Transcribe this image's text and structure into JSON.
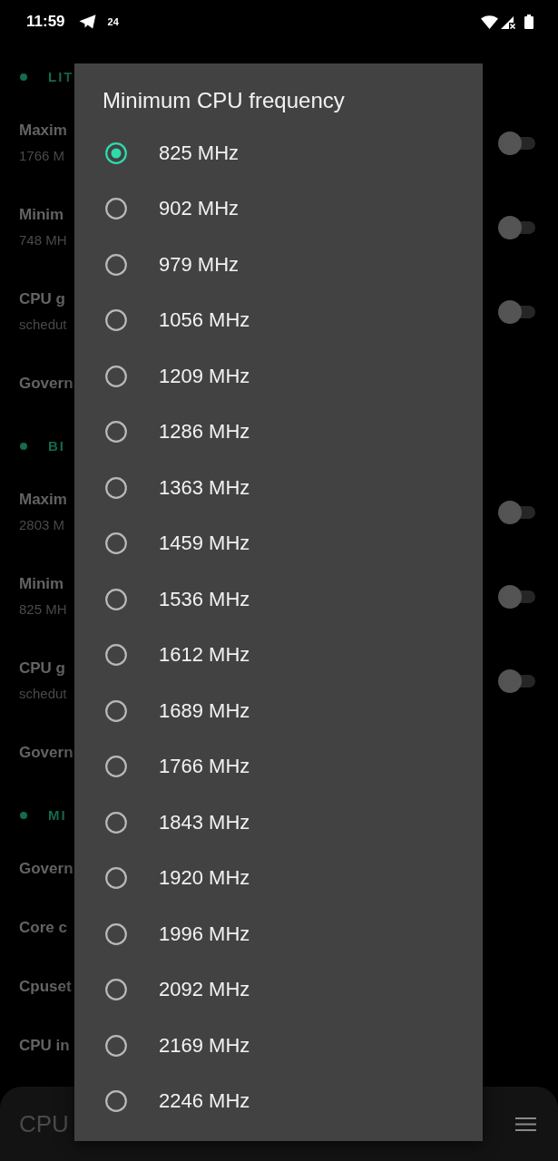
{
  "status_bar": {
    "time": "11:59",
    "notification_text": "24"
  },
  "sections": [
    {
      "header": "LIT",
      "items": [
        {
          "kind": "toggle",
          "title": "Maxim",
          "value": "1766 M",
          "on": false
        },
        {
          "kind": "toggle",
          "title": "Minim",
          "value": "748 MH",
          "on": false
        },
        {
          "kind": "toggle",
          "title": "CPU g",
          "value": "schedut",
          "on": false
        },
        {
          "kind": "plain",
          "title": "Govern"
        }
      ]
    },
    {
      "header": "BI",
      "items": [
        {
          "kind": "toggle",
          "title": "Maxim",
          "value": "2803 M",
          "on": false
        },
        {
          "kind": "toggle",
          "title": "Minim",
          "value": "825 MH",
          "on": false
        },
        {
          "kind": "toggle",
          "title": "CPU g",
          "value": "schedut",
          "on": false
        },
        {
          "kind": "plain",
          "title": "Govern"
        }
      ]
    },
    {
      "header": "MI",
      "items": [
        {
          "kind": "plain",
          "title": "Govern"
        },
        {
          "kind": "plain",
          "title": "Core c"
        },
        {
          "kind": "plain",
          "title": "Cpuset"
        },
        {
          "kind": "plain",
          "title": "CPU in"
        }
      ]
    }
  ],
  "bottom_bar": {
    "title": "CPU"
  },
  "dialog": {
    "title": "Minimum CPU frequency",
    "options": [
      {
        "label": "825 MHz",
        "selected": true
      },
      {
        "label": "902 MHz",
        "selected": false
      },
      {
        "label": "979 MHz",
        "selected": false
      },
      {
        "label": "1056 MHz",
        "selected": false
      },
      {
        "label": "1209 MHz",
        "selected": false
      },
      {
        "label": "1286 MHz",
        "selected": false
      },
      {
        "label": "1363 MHz",
        "selected": false
      },
      {
        "label": "1459 MHz",
        "selected": false
      },
      {
        "label": "1536 MHz",
        "selected": false
      },
      {
        "label": "1612 MHz",
        "selected": false
      },
      {
        "label": "1689 MHz",
        "selected": false
      },
      {
        "label": "1766 MHz",
        "selected": false
      },
      {
        "label": "1843 MHz",
        "selected": false
      },
      {
        "label": "1920 MHz",
        "selected": false
      },
      {
        "label": "1996 MHz",
        "selected": false
      },
      {
        "label": "2092 MHz",
        "selected": false
      },
      {
        "label": "2169 MHz",
        "selected": false
      },
      {
        "label": "2246 MHz",
        "selected": false
      }
    ]
  }
}
